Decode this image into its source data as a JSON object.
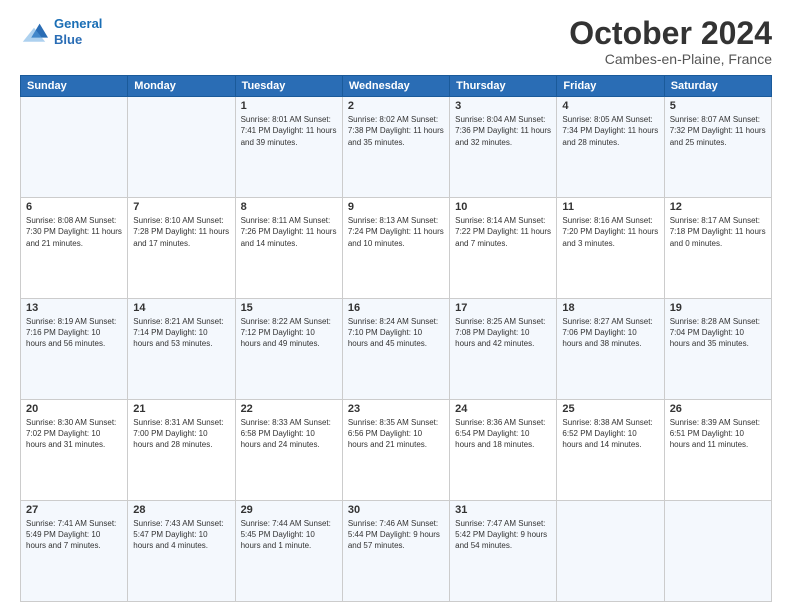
{
  "header": {
    "logo_line1": "General",
    "logo_line2": "Blue",
    "month": "October 2024",
    "location": "Cambes-en-Plaine, France"
  },
  "weekdays": [
    "Sunday",
    "Monday",
    "Tuesday",
    "Wednesday",
    "Thursday",
    "Friday",
    "Saturday"
  ],
  "weeks": [
    [
      {
        "day": "",
        "info": ""
      },
      {
        "day": "",
        "info": ""
      },
      {
        "day": "1",
        "info": "Sunrise: 8:01 AM\nSunset: 7:41 PM\nDaylight: 11 hours and 39 minutes."
      },
      {
        "day": "2",
        "info": "Sunrise: 8:02 AM\nSunset: 7:38 PM\nDaylight: 11 hours and 35 minutes."
      },
      {
        "day": "3",
        "info": "Sunrise: 8:04 AM\nSunset: 7:36 PM\nDaylight: 11 hours and 32 minutes."
      },
      {
        "day": "4",
        "info": "Sunrise: 8:05 AM\nSunset: 7:34 PM\nDaylight: 11 hours and 28 minutes."
      },
      {
        "day": "5",
        "info": "Sunrise: 8:07 AM\nSunset: 7:32 PM\nDaylight: 11 hours and 25 minutes."
      }
    ],
    [
      {
        "day": "6",
        "info": "Sunrise: 8:08 AM\nSunset: 7:30 PM\nDaylight: 11 hours and 21 minutes."
      },
      {
        "day": "7",
        "info": "Sunrise: 8:10 AM\nSunset: 7:28 PM\nDaylight: 11 hours and 17 minutes."
      },
      {
        "day": "8",
        "info": "Sunrise: 8:11 AM\nSunset: 7:26 PM\nDaylight: 11 hours and 14 minutes."
      },
      {
        "day": "9",
        "info": "Sunrise: 8:13 AM\nSunset: 7:24 PM\nDaylight: 11 hours and 10 minutes."
      },
      {
        "day": "10",
        "info": "Sunrise: 8:14 AM\nSunset: 7:22 PM\nDaylight: 11 hours and 7 minutes."
      },
      {
        "day": "11",
        "info": "Sunrise: 8:16 AM\nSunset: 7:20 PM\nDaylight: 11 hours and 3 minutes."
      },
      {
        "day": "12",
        "info": "Sunrise: 8:17 AM\nSunset: 7:18 PM\nDaylight: 11 hours and 0 minutes."
      }
    ],
    [
      {
        "day": "13",
        "info": "Sunrise: 8:19 AM\nSunset: 7:16 PM\nDaylight: 10 hours and 56 minutes."
      },
      {
        "day": "14",
        "info": "Sunrise: 8:21 AM\nSunset: 7:14 PM\nDaylight: 10 hours and 53 minutes."
      },
      {
        "day": "15",
        "info": "Sunrise: 8:22 AM\nSunset: 7:12 PM\nDaylight: 10 hours and 49 minutes."
      },
      {
        "day": "16",
        "info": "Sunrise: 8:24 AM\nSunset: 7:10 PM\nDaylight: 10 hours and 45 minutes."
      },
      {
        "day": "17",
        "info": "Sunrise: 8:25 AM\nSunset: 7:08 PM\nDaylight: 10 hours and 42 minutes."
      },
      {
        "day": "18",
        "info": "Sunrise: 8:27 AM\nSunset: 7:06 PM\nDaylight: 10 hours and 38 minutes."
      },
      {
        "day": "19",
        "info": "Sunrise: 8:28 AM\nSunset: 7:04 PM\nDaylight: 10 hours and 35 minutes."
      }
    ],
    [
      {
        "day": "20",
        "info": "Sunrise: 8:30 AM\nSunset: 7:02 PM\nDaylight: 10 hours and 31 minutes."
      },
      {
        "day": "21",
        "info": "Sunrise: 8:31 AM\nSunset: 7:00 PM\nDaylight: 10 hours and 28 minutes."
      },
      {
        "day": "22",
        "info": "Sunrise: 8:33 AM\nSunset: 6:58 PM\nDaylight: 10 hours and 24 minutes."
      },
      {
        "day": "23",
        "info": "Sunrise: 8:35 AM\nSunset: 6:56 PM\nDaylight: 10 hours and 21 minutes."
      },
      {
        "day": "24",
        "info": "Sunrise: 8:36 AM\nSunset: 6:54 PM\nDaylight: 10 hours and 18 minutes."
      },
      {
        "day": "25",
        "info": "Sunrise: 8:38 AM\nSunset: 6:52 PM\nDaylight: 10 hours and 14 minutes."
      },
      {
        "day": "26",
        "info": "Sunrise: 8:39 AM\nSunset: 6:51 PM\nDaylight: 10 hours and 11 minutes."
      }
    ],
    [
      {
        "day": "27",
        "info": "Sunrise: 7:41 AM\nSunset: 5:49 PM\nDaylight: 10 hours and 7 minutes."
      },
      {
        "day": "28",
        "info": "Sunrise: 7:43 AM\nSunset: 5:47 PM\nDaylight: 10 hours and 4 minutes."
      },
      {
        "day": "29",
        "info": "Sunrise: 7:44 AM\nSunset: 5:45 PM\nDaylight: 10 hours and 1 minute."
      },
      {
        "day": "30",
        "info": "Sunrise: 7:46 AM\nSunset: 5:44 PM\nDaylight: 9 hours and 57 minutes."
      },
      {
        "day": "31",
        "info": "Sunrise: 7:47 AM\nSunset: 5:42 PM\nDaylight: 9 hours and 54 minutes."
      },
      {
        "day": "",
        "info": ""
      },
      {
        "day": "",
        "info": ""
      }
    ]
  ]
}
